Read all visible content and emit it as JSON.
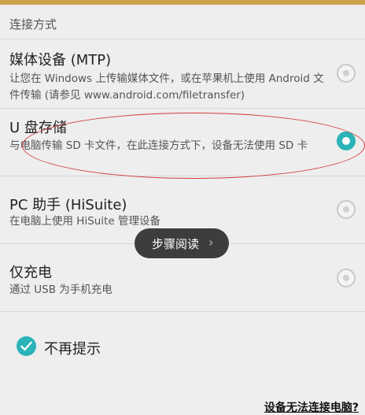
{
  "header": {
    "title": "连接方式"
  },
  "options": [
    {
      "title": "媒体设备 (MTP)",
      "description": "让您在 Windows 上传输媒体文件，或在苹果机上使用 Android 文件传输 (请参见 www.android.com/filetransfer)",
      "selected": false
    },
    {
      "title": "U 盘存储",
      "description": "与电脑传输 SD 卡文件，在此连接方式下，设备无法使用 SD 卡",
      "selected": true
    },
    {
      "title": "PC 助手 (HiSuite)",
      "description": "在电脑上使用 HiSuite 管理设备",
      "selected": false
    },
    {
      "title": "仅充电",
      "description": "通过 USB 为手机充电",
      "selected": false
    }
  ],
  "toast": {
    "label": "步骤阅读",
    "chevron": "›"
  },
  "dont_remind": {
    "label": "不再提示",
    "checked": true
  },
  "help_link": {
    "label": "设备无法连接电脑?"
  },
  "colors": {
    "accent": "#2ab3b8",
    "annotation": "#d23c3c",
    "toast_bg": "#3d3d3d"
  }
}
